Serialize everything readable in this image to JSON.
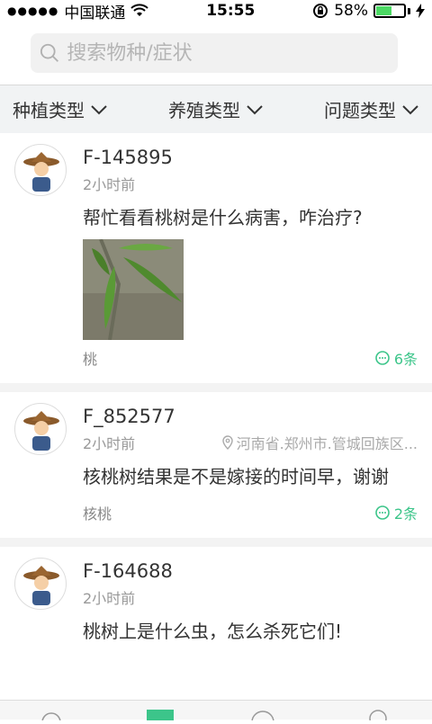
{
  "status": {
    "carrier": "中国联通",
    "time": "15:55",
    "battery": "58%",
    "battery_level": 0.58
  },
  "search": {
    "placeholder": "搜索物种/症状"
  },
  "filters": [
    "种植类型",
    "养殖类型",
    "问题类型"
  ],
  "posts": [
    {
      "user": "F-145895",
      "ago": "2小时前",
      "location": "",
      "question": "帮忙看看桃树是什么病害，咋治疗?",
      "tag": "桃",
      "answers": "6条",
      "has_photo": true
    },
    {
      "user": "F_852577",
      "ago": "2小时前",
      "location": "河南省.郑州市.管城回族区...",
      "question": "核桃树结果是不是嫁接的时间早，谢谢",
      "tag": "核桃",
      "answers": "2条",
      "has_photo": false
    },
    {
      "user": "F-164688",
      "ago": "2小时前",
      "location": "",
      "question": "桃树上是什么虫，怎么杀死它们!",
      "tag": "",
      "answers": "",
      "has_photo": false
    }
  ],
  "colors": {
    "accent": "#3cc58a",
    "battery": "#4cd964"
  }
}
